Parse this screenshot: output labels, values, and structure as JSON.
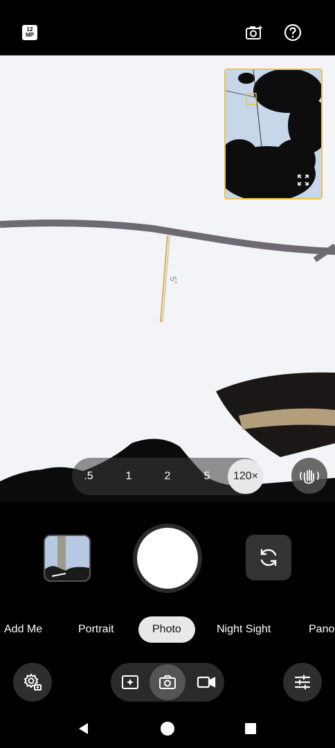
{
  "top_bar": {
    "resolution_badge": {
      "line1": "12",
      "line2": "MP"
    },
    "icons": [
      "camera-sparkle-icon",
      "help-icon"
    ]
  },
  "viewfinder": {
    "level_indicator_value": "5°",
    "minimap_expand_icon": "expand-icon"
  },
  "zoom": {
    "options": [
      ".5",
      "1",
      "2",
      "5"
    ],
    "active": "120×",
    "stabilization_icon": "hand-stabilize-icon"
  },
  "controls": {
    "thumbnail_icon": "gallery-thumbnail",
    "shutter_icon": "shutter-button",
    "switch_camera_icon": "switch-camera-icon"
  },
  "modes": [
    "Add Me",
    "Portrait",
    "Photo",
    "Night Sight",
    "Pano"
  ],
  "active_mode": "Photo",
  "bottom_bar": {
    "settings_icon": "settings-icon",
    "type_toggle": [
      "sparkle-frame-icon",
      "camera-icon",
      "video-icon"
    ],
    "active_type": "camera-icon",
    "adjust_icon": "sliders-icon"
  },
  "nav_bar": [
    "back-icon",
    "home-icon",
    "recents-icon"
  ]
}
